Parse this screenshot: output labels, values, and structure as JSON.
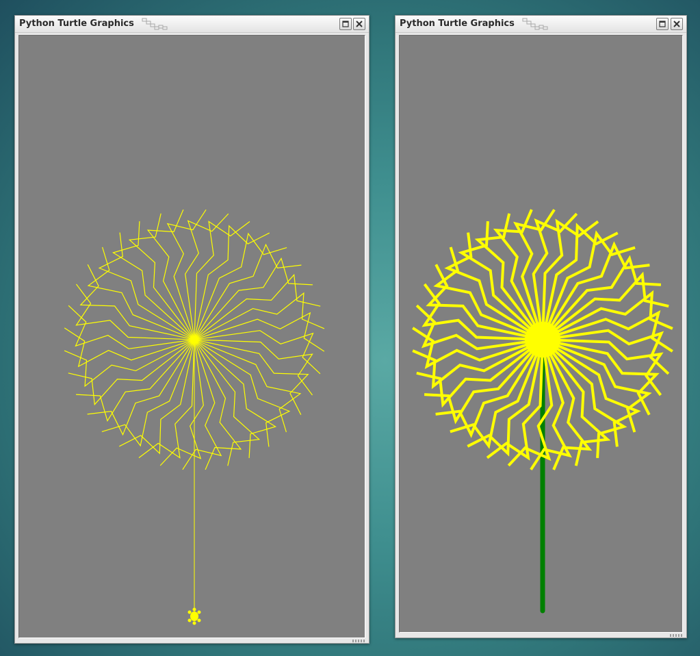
{
  "windows": [
    {
      "title": "Python Turtle Graphics",
      "canvas_background": "#808080",
      "flower_color": "#ffff00",
      "stem_color": "#ffff00",
      "line_style": "thin",
      "turtle_visible": true
    },
    {
      "title": "Python Turtle Graphics",
      "canvas_background": "#808080",
      "flower_color": "#ffff00",
      "stem_color": "#008000",
      "line_style": "thick",
      "turtle_visible": false
    }
  ],
  "icons": {
    "maximize": "maximize-icon",
    "close": "close-icon",
    "turtle": "turtle-icon"
  }
}
